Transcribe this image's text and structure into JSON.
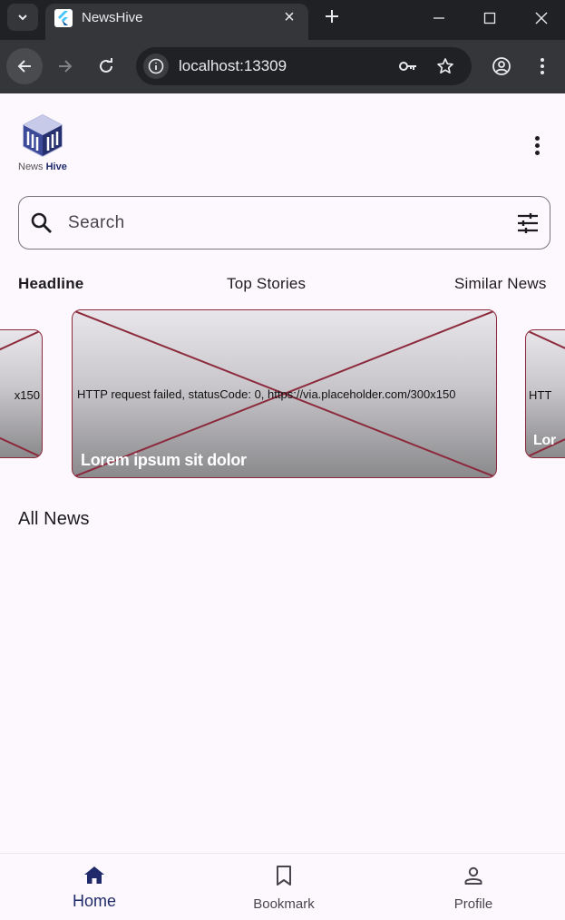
{
  "browser": {
    "tab_title": "NewsHive",
    "url": "localhost:13309"
  },
  "app": {
    "logo": {
      "prefix": "News",
      "suffix": "Hive"
    },
    "search": {
      "placeholder": "Search"
    },
    "tabs": [
      {
        "label": "Headline",
        "active": true
      },
      {
        "label": "Top Stories",
        "active": false
      },
      {
        "label": "Similar News",
        "active": false
      }
    ],
    "carousel": {
      "error_text": "HTTP request failed, statusCode: 0, https://via.placeholder.com/300x150",
      "left_peek_error": "x150",
      "right_peek_error": "HTT",
      "right_peek_title": "Lor",
      "card_title": "Lorem ipsum sit dolor"
    },
    "all_news_title": "All News",
    "bottom_nav": [
      {
        "label": "Home",
        "icon": "home-icon",
        "active": true
      },
      {
        "label": "Bookmark",
        "icon": "bookmark-icon",
        "active": false
      },
      {
        "label": "Profile",
        "icon": "person-icon",
        "active": false
      }
    ]
  },
  "colors": {
    "brand": "#1f2a6b",
    "placeholder_border": "#8c2a3c",
    "background": "#fdf8fd"
  }
}
